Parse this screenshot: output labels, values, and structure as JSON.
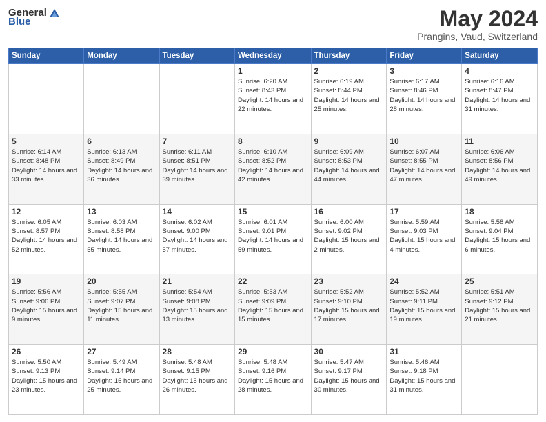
{
  "header": {
    "logo_general": "General",
    "logo_blue": "Blue",
    "month_title": "May 2024",
    "location": "Prangins, Vaud, Switzerland"
  },
  "weekdays": [
    "Sunday",
    "Monday",
    "Tuesday",
    "Wednesday",
    "Thursday",
    "Friday",
    "Saturday"
  ],
  "weeks": [
    [
      {
        "day": "",
        "sunrise": "",
        "sunset": "",
        "daylight": ""
      },
      {
        "day": "",
        "sunrise": "",
        "sunset": "",
        "daylight": ""
      },
      {
        "day": "",
        "sunrise": "",
        "sunset": "",
        "daylight": ""
      },
      {
        "day": "1",
        "sunrise": "Sunrise: 6:20 AM",
        "sunset": "Sunset: 8:43 PM",
        "daylight": "Daylight: 14 hours and 22 minutes."
      },
      {
        "day": "2",
        "sunrise": "Sunrise: 6:19 AM",
        "sunset": "Sunset: 8:44 PM",
        "daylight": "Daylight: 14 hours and 25 minutes."
      },
      {
        "day": "3",
        "sunrise": "Sunrise: 6:17 AM",
        "sunset": "Sunset: 8:46 PM",
        "daylight": "Daylight: 14 hours and 28 minutes."
      },
      {
        "day": "4",
        "sunrise": "Sunrise: 6:16 AM",
        "sunset": "Sunset: 8:47 PM",
        "daylight": "Daylight: 14 hours and 31 minutes."
      }
    ],
    [
      {
        "day": "5",
        "sunrise": "Sunrise: 6:14 AM",
        "sunset": "Sunset: 8:48 PM",
        "daylight": "Daylight: 14 hours and 33 minutes."
      },
      {
        "day": "6",
        "sunrise": "Sunrise: 6:13 AM",
        "sunset": "Sunset: 8:49 PM",
        "daylight": "Daylight: 14 hours and 36 minutes."
      },
      {
        "day": "7",
        "sunrise": "Sunrise: 6:11 AM",
        "sunset": "Sunset: 8:51 PM",
        "daylight": "Daylight: 14 hours and 39 minutes."
      },
      {
        "day": "8",
        "sunrise": "Sunrise: 6:10 AM",
        "sunset": "Sunset: 8:52 PM",
        "daylight": "Daylight: 14 hours and 42 minutes."
      },
      {
        "day": "9",
        "sunrise": "Sunrise: 6:09 AM",
        "sunset": "Sunset: 8:53 PM",
        "daylight": "Daylight: 14 hours and 44 minutes."
      },
      {
        "day": "10",
        "sunrise": "Sunrise: 6:07 AM",
        "sunset": "Sunset: 8:55 PM",
        "daylight": "Daylight: 14 hours and 47 minutes."
      },
      {
        "day": "11",
        "sunrise": "Sunrise: 6:06 AM",
        "sunset": "Sunset: 8:56 PM",
        "daylight": "Daylight: 14 hours and 49 minutes."
      }
    ],
    [
      {
        "day": "12",
        "sunrise": "Sunrise: 6:05 AM",
        "sunset": "Sunset: 8:57 PM",
        "daylight": "Daylight: 14 hours and 52 minutes."
      },
      {
        "day": "13",
        "sunrise": "Sunrise: 6:03 AM",
        "sunset": "Sunset: 8:58 PM",
        "daylight": "Daylight: 14 hours and 55 minutes."
      },
      {
        "day": "14",
        "sunrise": "Sunrise: 6:02 AM",
        "sunset": "Sunset: 9:00 PM",
        "daylight": "Daylight: 14 hours and 57 minutes."
      },
      {
        "day": "15",
        "sunrise": "Sunrise: 6:01 AM",
        "sunset": "Sunset: 9:01 PM",
        "daylight": "Daylight: 14 hours and 59 minutes."
      },
      {
        "day": "16",
        "sunrise": "Sunrise: 6:00 AM",
        "sunset": "Sunset: 9:02 PM",
        "daylight": "Daylight: 15 hours and 2 minutes."
      },
      {
        "day": "17",
        "sunrise": "Sunrise: 5:59 AM",
        "sunset": "Sunset: 9:03 PM",
        "daylight": "Daylight: 15 hours and 4 minutes."
      },
      {
        "day": "18",
        "sunrise": "Sunrise: 5:58 AM",
        "sunset": "Sunset: 9:04 PM",
        "daylight": "Daylight: 15 hours and 6 minutes."
      }
    ],
    [
      {
        "day": "19",
        "sunrise": "Sunrise: 5:56 AM",
        "sunset": "Sunset: 9:06 PM",
        "daylight": "Daylight: 15 hours and 9 minutes."
      },
      {
        "day": "20",
        "sunrise": "Sunrise: 5:55 AM",
        "sunset": "Sunset: 9:07 PM",
        "daylight": "Daylight: 15 hours and 11 minutes."
      },
      {
        "day": "21",
        "sunrise": "Sunrise: 5:54 AM",
        "sunset": "Sunset: 9:08 PM",
        "daylight": "Daylight: 15 hours and 13 minutes."
      },
      {
        "day": "22",
        "sunrise": "Sunrise: 5:53 AM",
        "sunset": "Sunset: 9:09 PM",
        "daylight": "Daylight: 15 hours and 15 minutes."
      },
      {
        "day": "23",
        "sunrise": "Sunrise: 5:52 AM",
        "sunset": "Sunset: 9:10 PM",
        "daylight": "Daylight: 15 hours and 17 minutes."
      },
      {
        "day": "24",
        "sunrise": "Sunrise: 5:52 AM",
        "sunset": "Sunset: 9:11 PM",
        "daylight": "Daylight: 15 hours and 19 minutes."
      },
      {
        "day": "25",
        "sunrise": "Sunrise: 5:51 AM",
        "sunset": "Sunset: 9:12 PM",
        "daylight": "Daylight: 15 hours and 21 minutes."
      }
    ],
    [
      {
        "day": "26",
        "sunrise": "Sunrise: 5:50 AM",
        "sunset": "Sunset: 9:13 PM",
        "daylight": "Daylight: 15 hours and 23 minutes."
      },
      {
        "day": "27",
        "sunrise": "Sunrise: 5:49 AM",
        "sunset": "Sunset: 9:14 PM",
        "daylight": "Daylight: 15 hours and 25 minutes."
      },
      {
        "day": "28",
        "sunrise": "Sunrise: 5:48 AM",
        "sunset": "Sunset: 9:15 PM",
        "daylight": "Daylight: 15 hours and 26 minutes."
      },
      {
        "day": "29",
        "sunrise": "Sunrise: 5:48 AM",
        "sunset": "Sunset: 9:16 PM",
        "daylight": "Daylight: 15 hours and 28 minutes."
      },
      {
        "day": "30",
        "sunrise": "Sunrise: 5:47 AM",
        "sunset": "Sunset: 9:17 PM",
        "daylight": "Daylight: 15 hours and 30 minutes."
      },
      {
        "day": "31",
        "sunrise": "Sunrise: 5:46 AM",
        "sunset": "Sunset: 9:18 PM",
        "daylight": "Daylight: 15 hours and 31 minutes."
      },
      {
        "day": "",
        "sunrise": "",
        "sunset": "",
        "daylight": ""
      }
    ]
  ]
}
